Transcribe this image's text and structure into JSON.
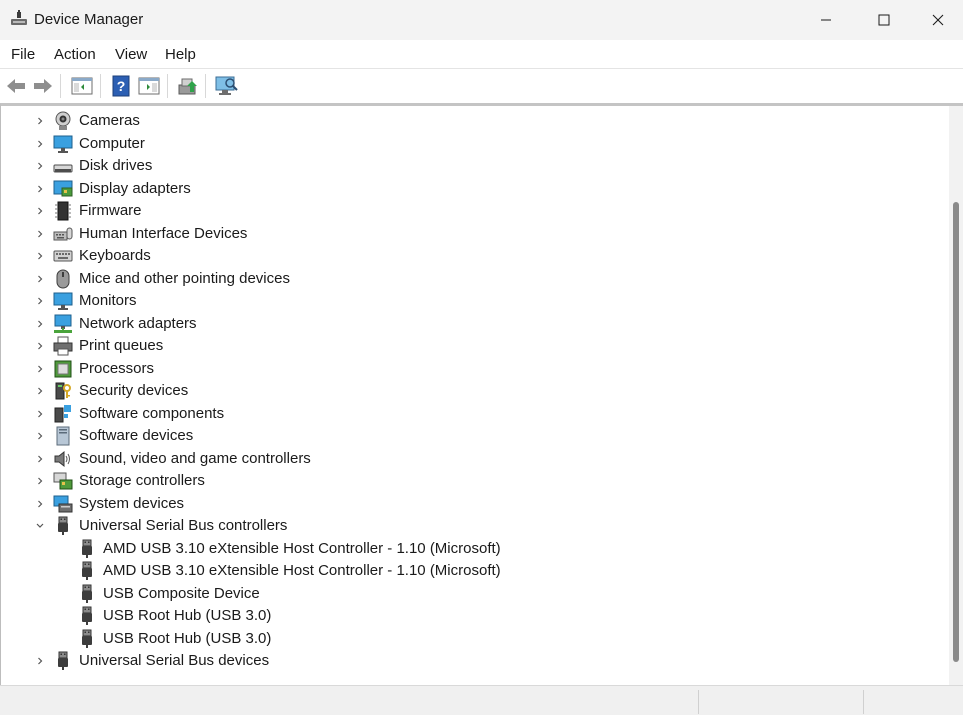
{
  "window": {
    "title": "Device Manager"
  },
  "menu": [
    "File",
    "Action",
    "View",
    "Help"
  ],
  "toolbar_icons": [
    "back-arrow-icon",
    "forward-arrow-icon",
    "show-hide-tree-icon",
    "help-icon",
    "properties-icon",
    "update-driver-icon",
    "scan-hardware-icon"
  ],
  "tree": [
    {
      "label": "Cameras",
      "icon": "camera-icon"
    },
    {
      "label": "Computer",
      "icon": "computer-icon"
    },
    {
      "label": "Disk drives",
      "icon": "disk-drive-icon"
    },
    {
      "label": "Display adapters",
      "icon": "display-adapter-icon"
    },
    {
      "label": "Firmware",
      "icon": "firmware-chip-icon"
    },
    {
      "label": "Human Interface Devices",
      "icon": "hid-icon"
    },
    {
      "label": "Keyboards",
      "icon": "keyboard-icon"
    },
    {
      "label": "Mice and other pointing devices",
      "icon": "mouse-icon"
    },
    {
      "label": "Monitors",
      "icon": "monitor-icon"
    },
    {
      "label": "Network adapters",
      "icon": "network-adapter-icon"
    },
    {
      "label": "Print queues",
      "icon": "printer-icon"
    },
    {
      "label": "Processors",
      "icon": "processor-icon"
    },
    {
      "label": "Security devices",
      "icon": "security-device-icon"
    },
    {
      "label": "Software components",
      "icon": "software-component-icon"
    },
    {
      "label": "Software devices",
      "icon": "software-device-icon"
    },
    {
      "label": "Sound, video and game controllers",
      "icon": "speaker-icon"
    },
    {
      "label": "Storage controllers",
      "icon": "storage-controller-icon"
    },
    {
      "label": "System devices",
      "icon": "system-device-icon"
    },
    {
      "label": "Universal Serial Bus controllers",
      "icon": "usb-icon",
      "expanded": true,
      "children": [
        "AMD USB 3.10 eXtensible Host Controller - 1.10 (Microsoft)",
        "AMD USB 3.10 eXtensible Host Controller - 1.10 (Microsoft)",
        "USB Composite Device",
        "USB Root Hub (USB 3.0)",
        "USB Root Hub (USB 3.0)"
      ]
    },
    {
      "label": "Universal Serial Bus devices",
      "icon": "usb-icon"
    }
  ]
}
